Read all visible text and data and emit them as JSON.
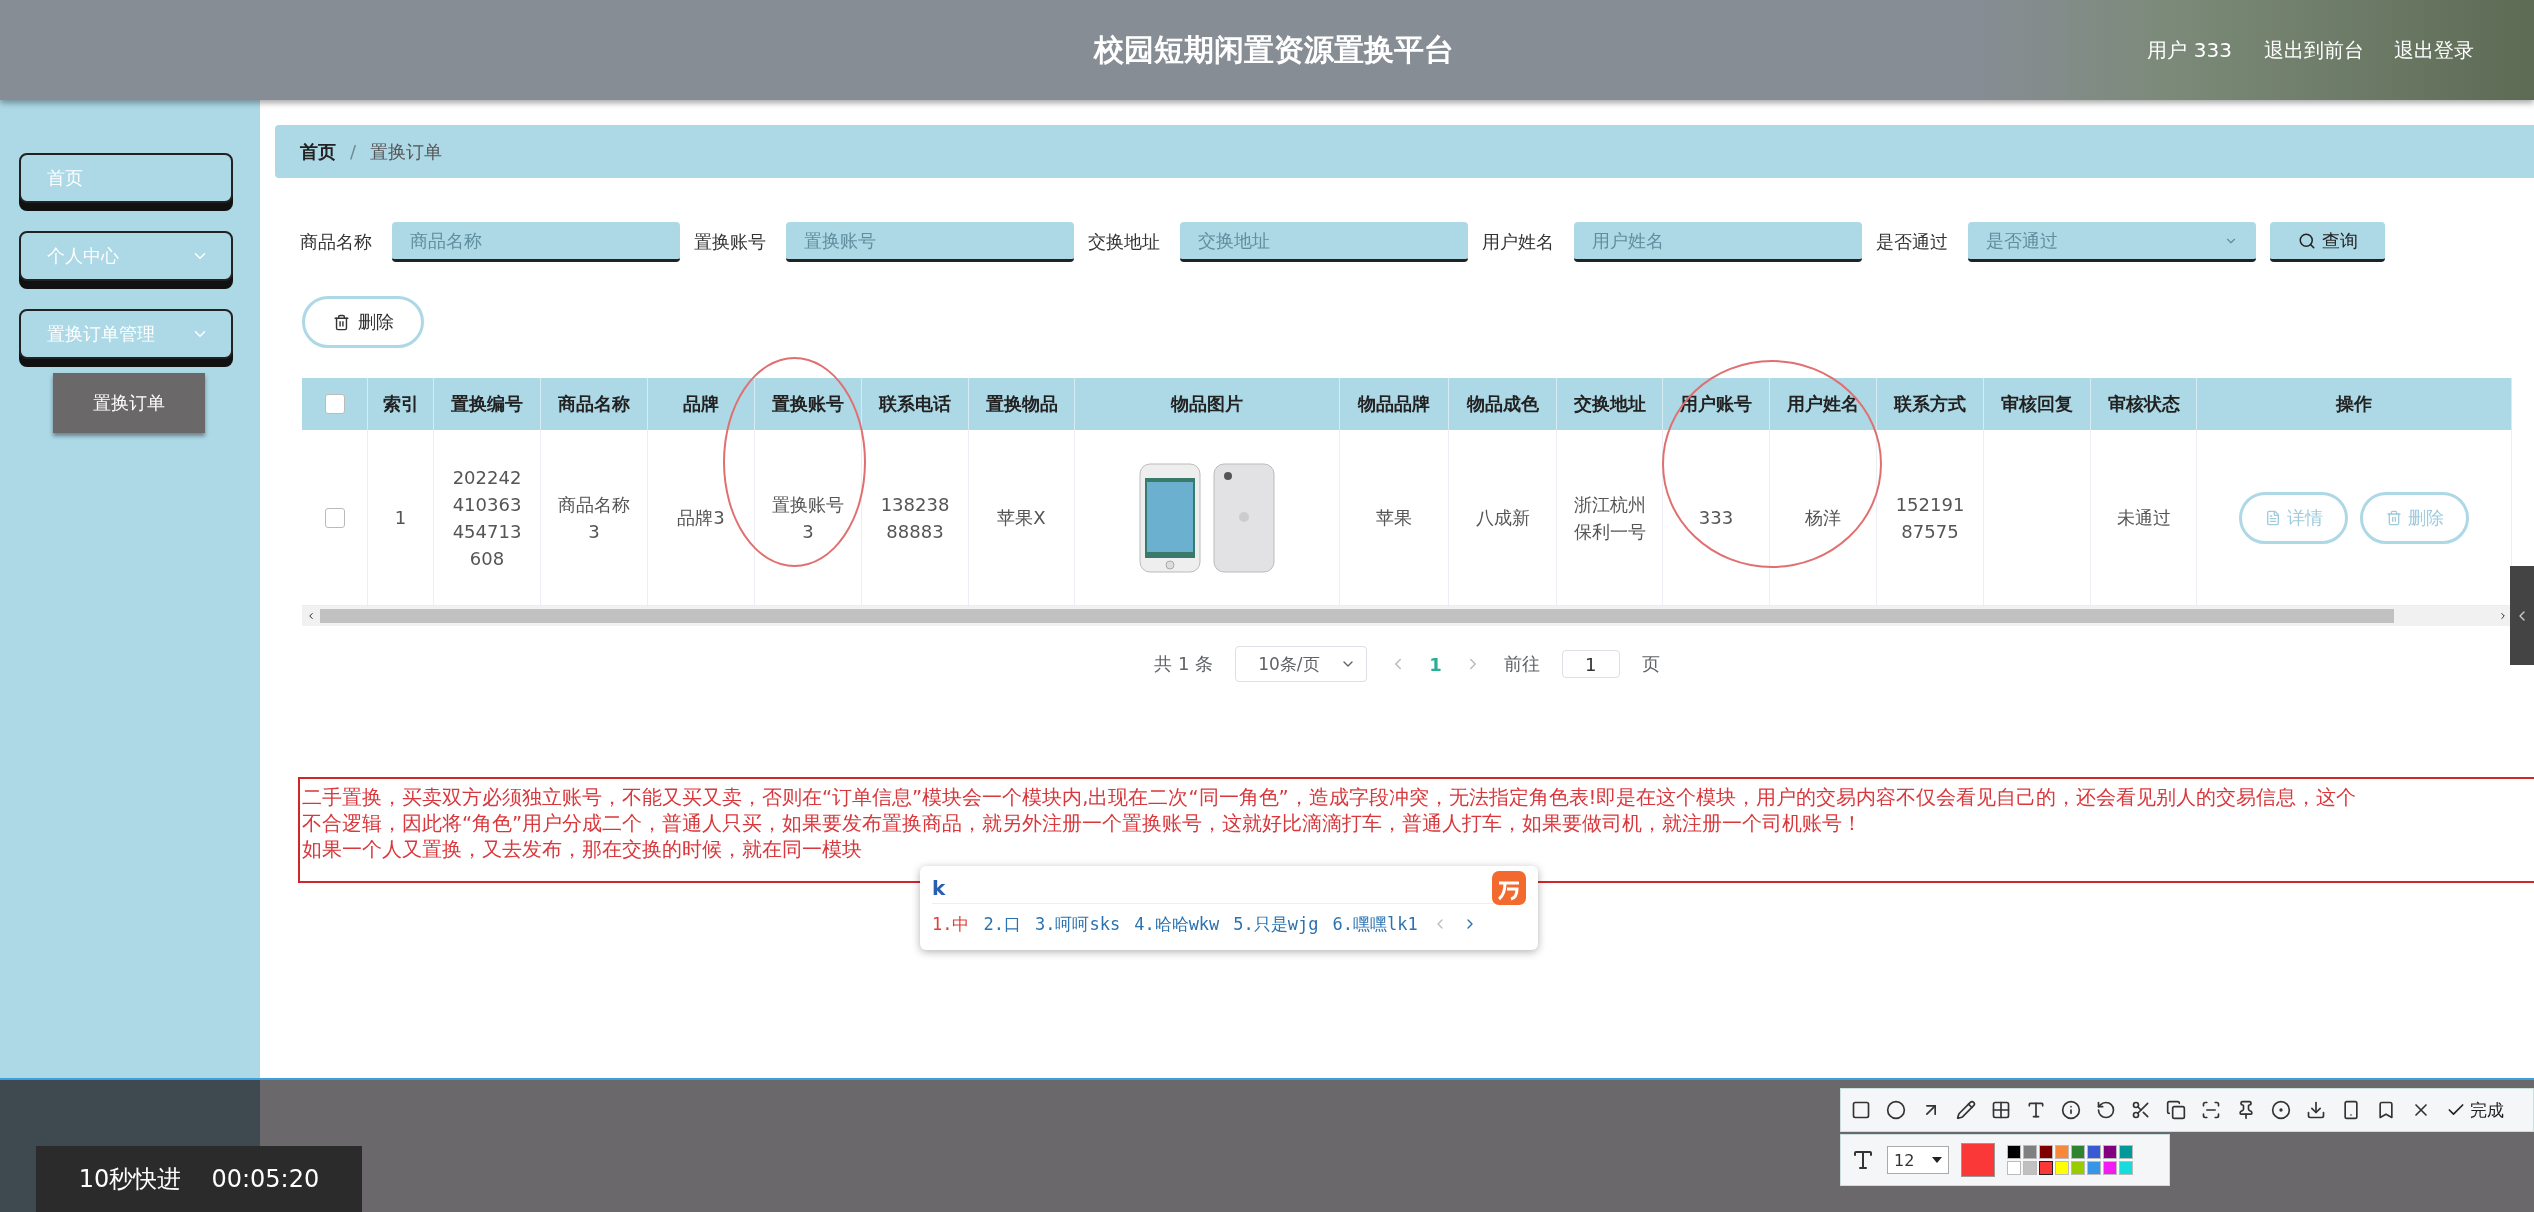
{
  "header": {
    "title": "校园短期闲置资源置换平台",
    "user": "用户 333",
    "links": [
      "退出到前台",
      "退出登录"
    ]
  },
  "sidebar": {
    "items": [
      {
        "label": "首页",
        "kind": "link"
      },
      {
        "label": "个人中心",
        "kind": "menu"
      },
      {
        "label": "置换订单管理",
        "kind": "menu",
        "children": [
          {
            "label": "置换订单",
            "selected": true
          }
        ]
      }
    ]
  },
  "breadcrumb": [
    "首页",
    "置换订单"
  ],
  "breadcrumb_separator": "/",
  "search": {
    "fields": [
      {
        "label": "商品名称",
        "placeholder": "商品名称",
        "kind": "text"
      },
      {
        "label": "置换账号",
        "placeholder": "置换账号",
        "kind": "text"
      },
      {
        "label": "交换地址",
        "placeholder": "交换地址",
        "kind": "text"
      },
      {
        "label": "用户姓名",
        "placeholder": "用户姓名",
        "kind": "text"
      },
      {
        "label": "是否通过",
        "placeholder": "是否通过",
        "kind": "select"
      }
    ],
    "button": "查询"
  },
  "delete_button": "删除",
  "table": {
    "all_checked": false,
    "columns": [
      {
        "label": "索引",
        "kind": "text"
      },
      {
        "label": "置换编号",
        "kind": "text"
      },
      {
        "label": "商品名称",
        "kind": "text"
      },
      {
        "label": "品牌",
        "kind": "text"
      },
      {
        "label": "置换账号",
        "kind": "text"
      },
      {
        "label": "联系电话",
        "kind": "text"
      },
      {
        "label": "置换物品",
        "kind": "text"
      },
      {
        "label": "物品图片",
        "kind": "image"
      },
      {
        "label": "物品品牌",
        "kind": "text"
      },
      {
        "label": "物品成色",
        "kind": "text"
      },
      {
        "label": "交换地址",
        "kind": "text"
      },
      {
        "label": "用户账号",
        "kind": "text"
      },
      {
        "label": "用户姓名",
        "kind": "text"
      },
      {
        "label": "联系方式",
        "kind": "text"
      },
      {
        "label": "审核回复",
        "kind": "text"
      },
      {
        "label": "审核状态",
        "kind": "text"
      },
      {
        "label": "操作",
        "kind": "actions"
      }
    ],
    "rows": [
      {
        "checked": false,
        "cells": [
          "1",
          "202242410363454713608",
          "商品名称3",
          "品牌3",
          "置换账号3",
          "13823888883",
          "苹果X",
          null,
          "苹果",
          "八成新",
          "浙江杭州保利一号",
          "333",
          "杨洋",
          "15219187575",
          "",
          "未通过"
        ],
        "actions": [
          "详情",
          "删除"
        ]
      }
    ]
  },
  "pagination": {
    "total": "共 1 条",
    "page_size": "10条/页",
    "pages": [
      {
        "label": "1",
        "selected": true
      }
    ],
    "goto_label": "前往",
    "goto_value": "1",
    "goto_unit": "页"
  },
  "annotation": {
    "lines": [
      "二手置换，买卖双方必须独立账号，不能又买又卖，否则在“订单信息”模块会一个模块内,出现在二次“同一角色”，造成字段冲突，无法指定角色表!即是在这个模块，用户的交易内容不仅会看见自己的，还会看见别人的交易信息，这个",
      "不合逻辑，因此将“角色”用户分成二个，普通人只买，如果要发布置换商品，就另外注册一个置换账号，这就好比滴滴打车，普通人打车，如果要做司机，就注册一个司机账号！",
      "如果一个人又置换，又去发布，那在交换的时候，就在同一模块"
    ]
  },
  "ime": {
    "input": "k",
    "candidates": [
      {
        "label": "1.中",
        "selected": true
      },
      {
        "label": "2.口",
        "selected": false
      },
      {
        "label": "3.呵呵sks",
        "selected": false
      },
      {
        "label": "4.哈哈wkw",
        "selected": false
      },
      {
        "label": "5.只是wjg",
        "selected": false
      },
      {
        "label": "6.嘿嘿lk1",
        "selected": false
      }
    ]
  },
  "video_overlay": {
    "label": "10秒快进",
    "time": "00:05:20"
  },
  "capture_toolbar": {
    "done": "完成",
    "font_size": "12",
    "palette": [
      {
        "color": "#000000",
        "selected": false
      },
      {
        "color": "#808080",
        "selected": false
      },
      {
        "color": "#800000",
        "selected": false
      },
      {
        "color": "#f7883a",
        "selected": false
      },
      {
        "color": "#308430",
        "selected": false
      },
      {
        "color": "#385ad3",
        "selected": false
      },
      {
        "color": "#800080",
        "selected": false
      },
      {
        "color": "#009999",
        "selected": false
      },
      {
        "color": "#ffffff",
        "selected": false
      },
      {
        "color": "#c0c0c0",
        "selected": false
      },
      {
        "color": "#fb3838",
        "selected": true
      },
      {
        "color": "#ffff00",
        "selected": false
      },
      {
        "color": "#99cc00",
        "selected": false
      },
      {
        "color": "#3894e4",
        "selected": false
      },
      {
        "color": "#f31bf3",
        "selected": false
      },
      {
        "color": "#16dcdc",
        "selected": false
      }
    ]
  }
}
